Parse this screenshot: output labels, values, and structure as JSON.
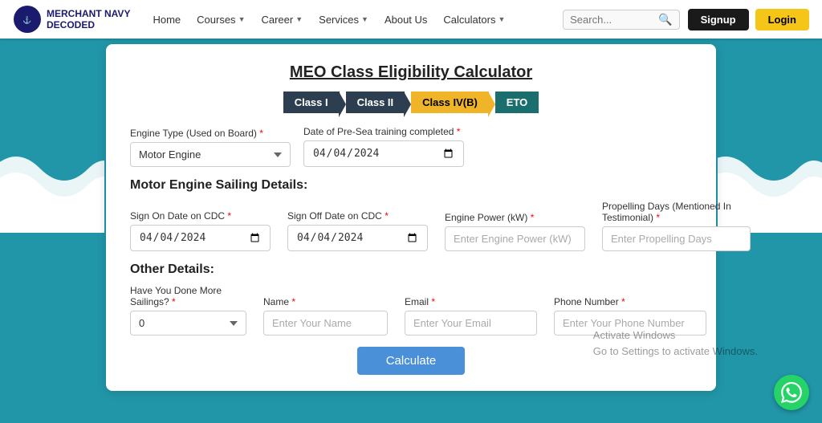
{
  "navbar": {
    "logo_line1": "MERCHANT NAVY",
    "logo_line2": "DECODED",
    "links": [
      {
        "label": "Home",
        "has_caret": false
      },
      {
        "label": "Courses",
        "has_caret": true
      },
      {
        "label": "Career",
        "has_caret": true
      },
      {
        "label": "Services",
        "has_caret": true
      },
      {
        "label": "About Us",
        "has_caret": false
      },
      {
        "label": "Calculators",
        "has_caret": true
      }
    ],
    "search_placeholder": "Search...",
    "signup_label": "Signup",
    "login_label": "Login"
  },
  "calculator": {
    "title": "MEO Class Eligibility Calculator",
    "tabs": [
      {
        "label": "Class I",
        "style": "dark"
      },
      {
        "label": "Class II",
        "style": "dark"
      },
      {
        "label": "Class IV(B)",
        "style": "yellow"
      },
      {
        "label": "ETO",
        "style": "teal"
      }
    ],
    "engine_type_label": "Engine Type (Used on Board)",
    "engine_type_value": "Motor Engine",
    "presea_date_label": "Date of Pre-Sea training completed",
    "presea_date_value": "04-04-2024",
    "sailing_details_title": "Motor Engine Sailing Details:",
    "sign_on_label": "Sign On Date on CDC",
    "sign_on_value": "04-04-2024",
    "sign_off_label": "Sign Off Date on CDC",
    "sign_off_value": "04-04-2024",
    "engine_power_label": "Engine Power (kW)",
    "engine_power_placeholder": "Enter Engine Power (kW)",
    "propelling_label": "Propelling Days (Mentioned In Testimonial)",
    "propelling_placeholder": "Enter Propelling Days",
    "other_details_title": "Other Details:",
    "sailings_label": "Have You Done More Sailings?",
    "sailings_value": "0",
    "name_label": "Name",
    "name_placeholder": "Enter Your Name",
    "email_label": "Email",
    "email_placeholder": "Enter Your Email",
    "phone_label": "Phone Number",
    "phone_placeholder": "Enter Your Phone Number",
    "calculate_btn": "Calculate"
  },
  "windows_watermark": {
    "line1": "Activate Windows",
    "line2": "Go to Settings to activate Windows."
  }
}
